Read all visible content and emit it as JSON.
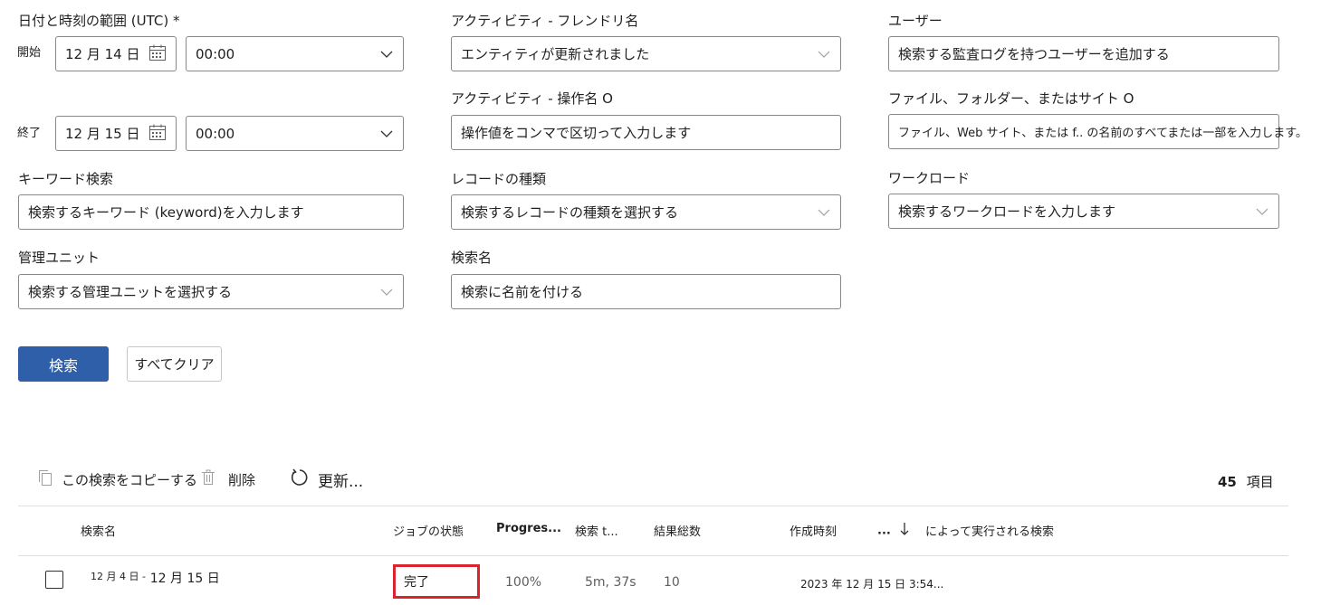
{
  "date_range": {
    "label": "日付と時刻の範囲 (UTC) *",
    "start_label": "開始",
    "start_date": "12 月 14 日",
    "start_time": "00:00",
    "end_label": "終了",
    "end_date": "12 月 15 日",
    "end_time": "00:00"
  },
  "activity_friendly": {
    "label": "アクティビティ - フレンドリ名",
    "value": "エンティティが更新されました"
  },
  "activity_operation": {
    "label": "アクティビティ - 操作名 O",
    "placeholder": "操作値をコンマで区切って入力します"
  },
  "keyword": {
    "label": "キーワード検索",
    "placeholder": "検索するキーワード (keyword)を入力します"
  },
  "record_type": {
    "label": "レコードの種類",
    "placeholder": "検索するレコードの種類を選択する"
  },
  "admin_unit": {
    "label": "管理ユニット",
    "placeholder": "検索する管理ユニットを選択する"
  },
  "search_name": {
    "label": "検索名",
    "placeholder": "検索に名前を付ける"
  },
  "users": {
    "label": "ユーザー",
    "placeholder": "検索する監査ログを持つユーザーを追加する"
  },
  "files": {
    "label": "ファイル、フォルダー、またはサイト O",
    "placeholder": "ファイル、Web サイト、または f.. の名前のすべてまたは一部を入力します。"
  },
  "workload": {
    "label": "ワークロード",
    "placeholder": "検索するワークロードを入力します"
  },
  "actions": {
    "search": "検索",
    "clear_all": "すべてクリア"
  },
  "toolbar": {
    "copy": "この検索をコピーする",
    "delete": "削除",
    "refresh": "更新...",
    "count": "45",
    "count_unit": "項目"
  },
  "table": {
    "headers": {
      "name": "検索名",
      "job_status": "ジョブの状態",
      "progress": "Progres...",
      "search_time": "検索 t...",
      "total_results": "結果総数",
      "created": "作成時刻",
      "sort": "...",
      "run_by": "によって実行される検索"
    },
    "rows": [
      {
        "name_prefix": "12 月 4 日 -",
        "name": "12 月 15 日",
        "status": "完了",
        "progress": "100%",
        "search_time": "5m, 37s",
        "total_results": "10",
        "created": "2023 年 12 月 15 日 3:54..."
      }
    ]
  },
  "colors": {
    "primary": "#2e5fa8",
    "highlight": "#d9232d",
    "border": "#8a8886"
  }
}
